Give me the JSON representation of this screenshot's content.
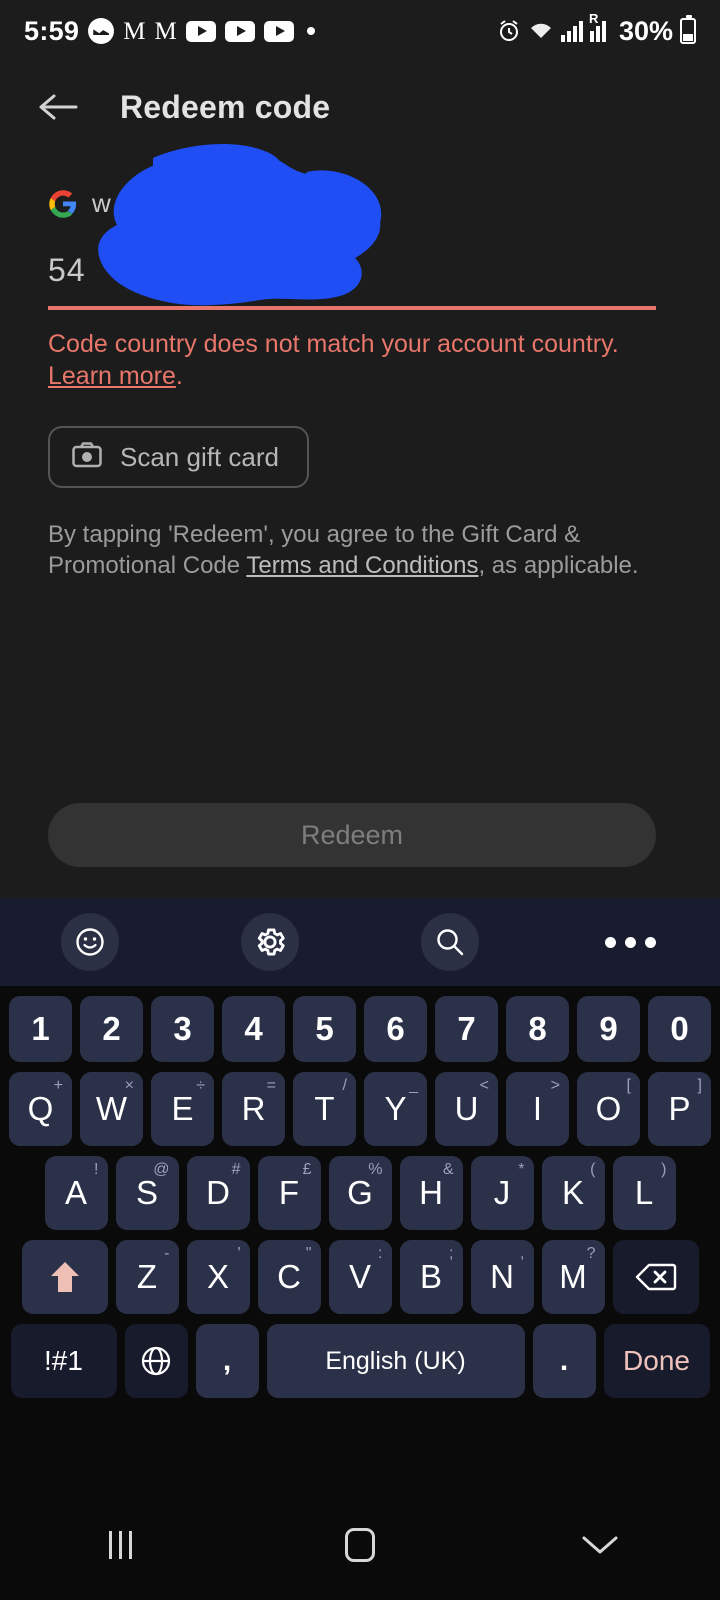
{
  "status_bar": {
    "time": "5:59",
    "left_icons": [
      "messenger-icon",
      "gmail-icon",
      "gmail-icon",
      "youtube-icon",
      "youtube-icon",
      "youtube-icon",
      "notification-dot"
    ],
    "alarm_icon": "alarm-icon",
    "wifi_icon": "wifi-icon",
    "signal_icon": "signal-bars-icon",
    "roaming_label": "R",
    "battery_percent": "30%"
  },
  "app_bar": {
    "back_icon": "back-arrow-icon",
    "title": "Redeem code"
  },
  "account": {
    "provider_icon": "google-g-icon",
    "email": "w"
  },
  "code_field": {
    "value": "54",
    "underline_color": "#e8766b"
  },
  "error": {
    "message": "Code country does not match your account country. ",
    "link_text": "Learn more",
    "period": ".",
    "color": "#e8766b"
  },
  "scan_button": {
    "icon": "camera-icon",
    "label": "Scan gift card"
  },
  "terms": {
    "part1": "By tapping 'Redeem', you agree to the Gift Card & Promotional Code ",
    "link": "Terms and Conditions",
    "part2": ", as applicable."
  },
  "redeem_button": {
    "label": "Redeem",
    "enabled": false
  },
  "redaction": {
    "color": "#1f4ef5",
    "shape": "blue-scribble-blob"
  },
  "keyboard": {
    "toolbar": [
      {
        "name": "emoji-icon"
      },
      {
        "name": "gear-icon"
      },
      {
        "name": "search-icon"
      },
      {
        "name": "more-options-icon"
      }
    ],
    "rows": {
      "numbers": [
        "1",
        "2",
        "3",
        "4",
        "5",
        "6",
        "7",
        "8",
        "9",
        "0"
      ],
      "top": [
        {
          "main": "Q",
          "sub": "+"
        },
        {
          "main": "W",
          "sub": "×"
        },
        {
          "main": "E",
          "sub": "÷"
        },
        {
          "main": "R",
          "sub": "="
        },
        {
          "main": "T",
          "sub": "/"
        },
        {
          "main": "Y",
          "sub": "_"
        },
        {
          "main": "U",
          "sub": "<"
        },
        {
          "main": "I",
          "sub": ">"
        },
        {
          "main": "O",
          "sub": "["
        },
        {
          "main": "P",
          "sub": "]"
        }
      ],
      "home": [
        {
          "main": "A",
          "sub": "!"
        },
        {
          "main": "S",
          "sub": "@"
        },
        {
          "main": "D",
          "sub": "#"
        },
        {
          "main": "F",
          "sub": "£"
        },
        {
          "main": "G",
          "sub": "%"
        },
        {
          "main": "H",
          "sub": "&"
        },
        {
          "main": "J",
          "sub": "*"
        },
        {
          "main": "K",
          "sub": "("
        },
        {
          "main": "L",
          "sub": ")"
        }
      ],
      "bottom": [
        {
          "main": "Z",
          "sub": "-"
        },
        {
          "main": "X",
          "sub": "'"
        },
        {
          "main": "C",
          "sub": "\""
        },
        {
          "main": "V",
          "sub": ":"
        },
        {
          "main": "B",
          "sub": ";"
        },
        {
          "main": "N",
          "sub": ","
        },
        {
          "main": "M",
          "sub": "?"
        }
      ],
      "shift_icon": "shift-arrow-icon",
      "backspace_icon": "backspace-icon",
      "symbols_label": "!#1",
      "globe_icon": "language-globe-icon",
      "comma_label": ",",
      "space_label": "English (UK)",
      "period_label": ".",
      "done_label": "Done"
    }
  },
  "nav_bar": {
    "recents_icon": "recent-apps-icon",
    "home_icon": "home-icon",
    "dismiss_icon": "dismiss-keyboard-chevron-icon"
  }
}
